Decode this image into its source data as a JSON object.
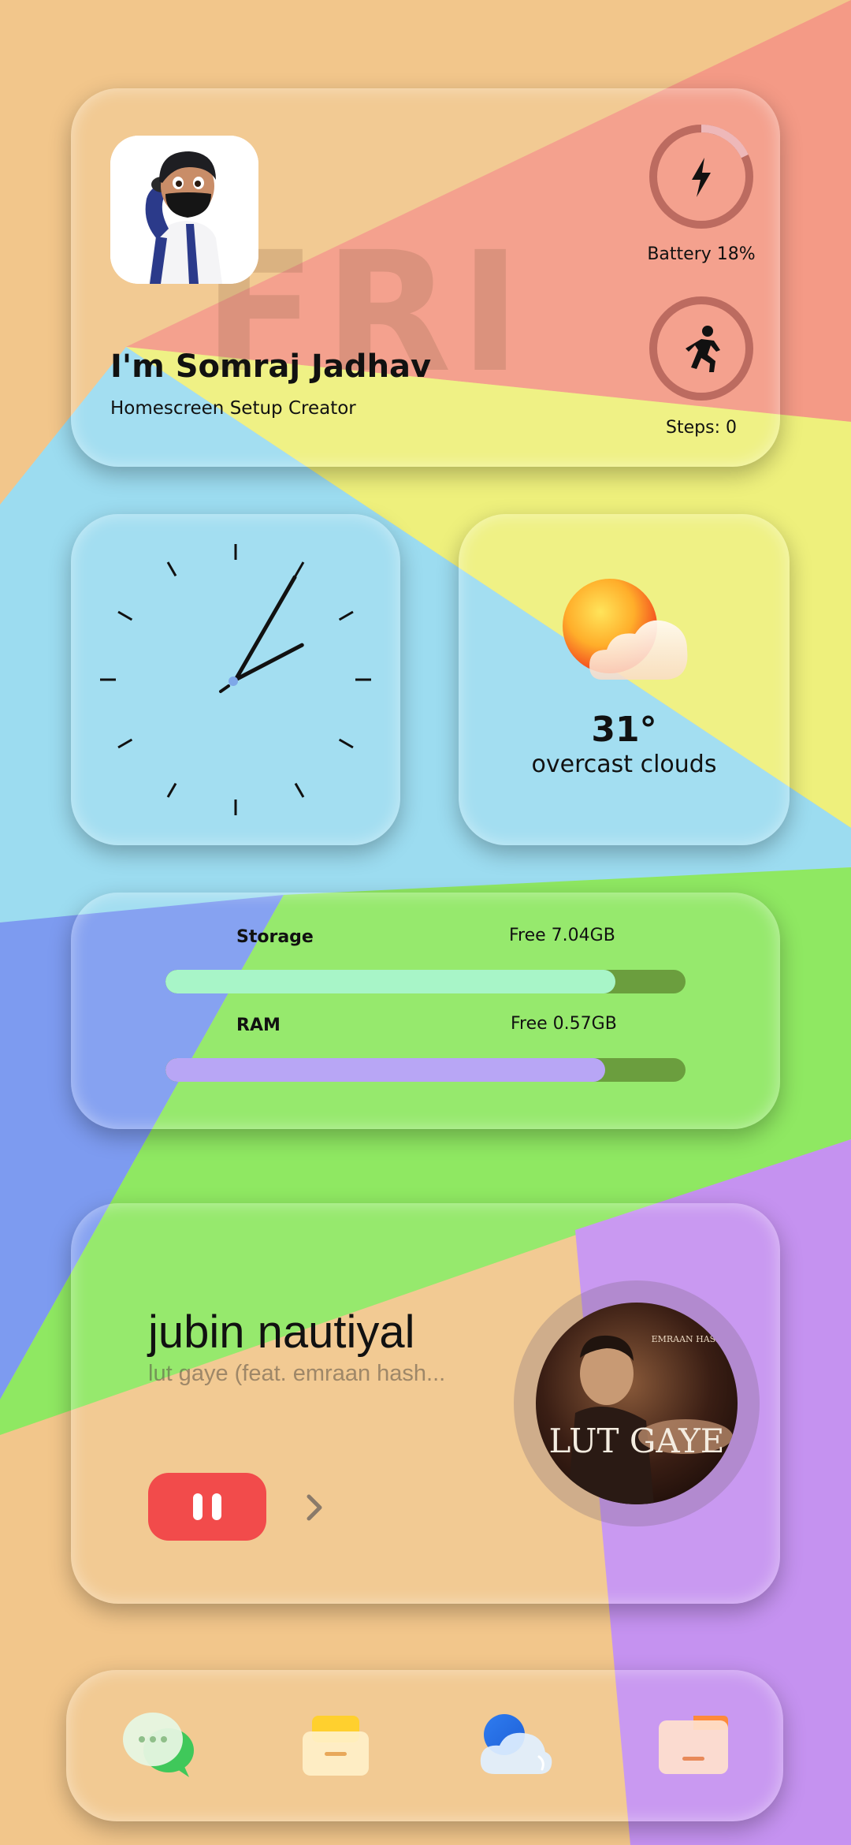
{
  "profile": {
    "day": "FRI",
    "name": "I'm Somraj Jadhav",
    "role": "Homescreen Setup Creator",
    "battery_label": "Battery 18%",
    "battery_level": 0.18,
    "steps_label": "Steps: 0",
    "steps_level": 0
  },
  "clock": {
    "hour": 2,
    "minute": 5
  },
  "weather": {
    "temperature": "31°",
    "description": "overcast clouds",
    "icon": "sun-behind-cloud-icon"
  },
  "storage": {
    "storage_label": "Storage",
    "storage_free": "Free 7.04GB",
    "storage_used_fraction": 0.865,
    "ram_label": "RAM",
    "ram_free": "Free 0.57GB",
    "ram_used_fraction": 0.845
  },
  "music": {
    "artist": "jubin nautiyal",
    "song": "lut gaye (feat. emraan hash...",
    "album_title": "LUT GAYE",
    "album_credit": "EMRAAN HASHMI",
    "state": "playing"
  },
  "dock": {
    "apps": [
      "messages-icon",
      "mail-icon",
      "cloud-icon",
      "files-icon"
    ]
  },
  "colors": {
    "background": "#f2c68b",
    "red": "#f49a86",
    "yellow": "#eef07c",
    "blue": "#9cdcf0",
    "green": "#8fe862",
    "indigo": "#7d9bf0",
    "purple": "#c592f0",
    "accent_red": "#f24b4b",
    "storage_bar": "#a8f5c8",
    "ram_bar": "#b8a6f5"
  }
}
